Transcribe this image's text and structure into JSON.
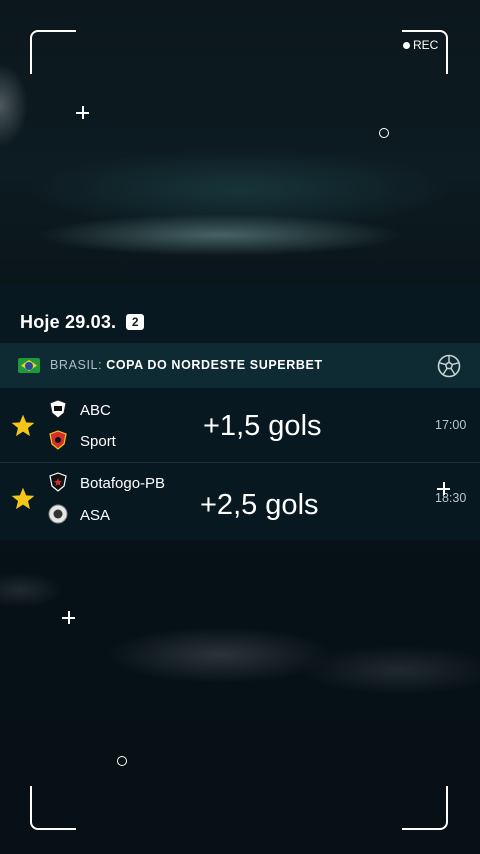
{
  "camera": {
    "rec_label": "REC"
  },
  "overlay": {
    "match1_text": "+1,5 gols",
    "match2_text": "+2,5 gols"
  },
  "date_header": {
    "label": "Hoje 29.03.",
    "count": "2"
  },
  "league": {
    "country": "BRASIL:",
    "name": "COPA DO NORDESTE SUPERBET",
    "flag_icon": "brazil-flag",
    "sport_icon": "soccer-ball-icon"
  },
  "matches": [
    {
      "home": "ABC",
      "away": "Sport",
      "time": "17:00",
      "favorite": true
    },
    {
      "home": "Botafogo-PB",
      "away": "ASA",
      "time": "18:30",
      "favorite": true
    }
  ],
  "colors": {
    "star": "#f5c518",
    "league_bar": "#0e2a33",
    "background": "#06121a"
  }
}
